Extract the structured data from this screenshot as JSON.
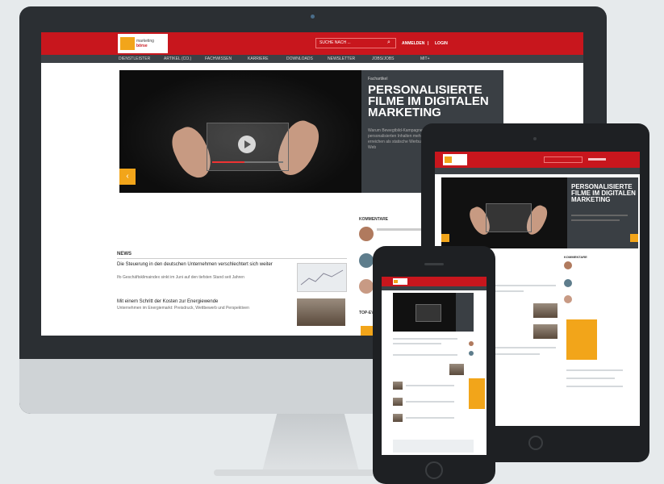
{
  "desktop": {
    "logo": {
      "line1": "marketing",
      "line2": "börse"
    },
    "search": {
      "placeholder": "SUCHE NACH ..."
    },
    "toplinks": [
      "ANMELDEN",
      "LOGIN"
    ],
    "toplink_separator": "|",
    "nav": [
      "DIENSTLEISTER",
      "ARTIKEL (CO.)",
      "FACHWISSEN",
      "KARRIERE",
      "DOWNLOADS",
      "NEWSLETTER",
      "JOBS/JOBS",
      "MIT+"
    ],
    "hero": {
      "kicker": "Fachartikel",
      "title": "PERSONALISIERTE FILME IM DIGITALEN MARKETING",
      "teaser": "Warum Bewegtbild-Kampagnen mit personalisierten Inhalten mehr erreichen als statische Werbung im Web"
    },
    "news": {
      "heading": "NEWS",
      "items": [
        {
          "title": "Die Steuerung in den deutschen Unternehmen verschlechtert sich weiter",
          "subtitle": "Ifo Geschäftsklimaindex sinkt im Juni auf den tiefsten Stand seit Jahren"
        },
        {
          "title": "Mit einem Schritt der Kosten zur Energiewende",
          "subtitle": "Unternehmen im Energiemarkt: Preisdruck, Wettbewerb und Perspektiven"
        }
      ]
    },
    "sidebar": {
      "heading": "KOMMENTARE",
      "heading2": "TOP-EVENTS"
    }
  },
  "tablet": {
    "hero_title": "PERSONALISIERTE FILME IM DIGITALEN MARKETING",
    "sidebar_heading": "KOMMENTARE"
  },
  "colors": {
    "brand_red": "#c8161d",
    "accent_orange": "#f2a51a",
    "nav_dark": "#3c4146",
    "device_dark": "#1e2023"
  },
  "icons": [
    "search-icon",
    "play-icon",
    "arrow-left-icon"
  ]
}
